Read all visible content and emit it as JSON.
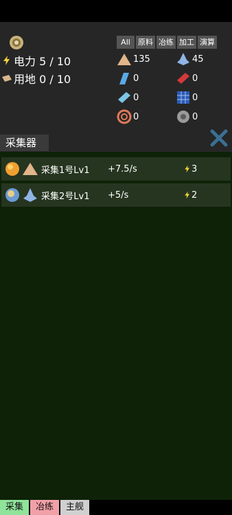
{
  "stats": {
    "power": "电力 5 / 10",
    "land": "用地 0 / 10"
  },
  "filter_tabs": [
    "All",
    "原料",
    "冶练",
    "加工",
    "演算"
  ],
  "resources": [
    {
      "icon": "sand-pile-icon",
      "value": "135"
    },
    {
      "icon": "crystal-icon",
      "value": "45"
    },
    {
      "icon": "blue-plate-icon",
      "value": "0"
    },
    {
      "icon": "copper-ingot-icon",
      "value": "0"
    },
    {
      "icon": "iron-ingot-icon",
      "value": "0"
    },
    {
      "icon": "solar-panel-icon",
      "value": "0"
    },
    {
      "icon": "copper-coil-icon",
      "value": "0"
    },
    {
      "icon": "gear-part-icon",
      "value": "0"
    }
  ],
  "section": {
    "title": "采集器"
  },
  "collectors": [
    {
      "name": "采集1号Lv1",
      "rate": "+7.5/s",
      "power": "3"
    },
    {
      "name": "采集2号Lv1",
      "rate": "+5/s",
      "power": "2"
    }
  ],
  "bottom_tabs": [
    {
      "label": "采集",
      "color": "#8fe39a"
    },
    {
      "label": "冶练",
      "color": "#f2a0a8"
    },
    {
      "label": "主舰",
      "color": "#d0d0d0"
    }
  ]
}
